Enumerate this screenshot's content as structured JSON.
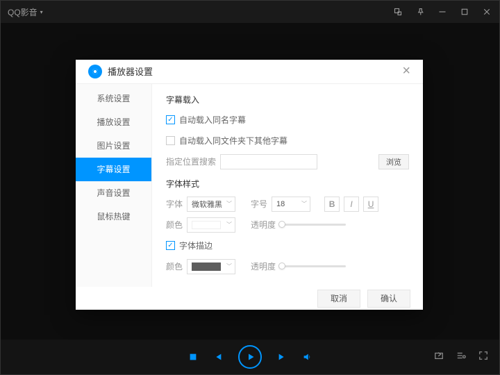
{
  "app": {
    "title": "QQ影音"
  },
  "dialog": {
    "title": "播放器设置",
    "sidebar": {
      "items": [
        {
          "label": "系统设置"
        },
        {
          "label": "播放设置"
        },
        {
          "label": "图片设置"
        },
        {
          "label": "字幕设置"
        },
        {
          "label": "声音设置"
        },
        {
          "label": "鼠标热键"
        }
      ],
      "active_index": 3
    },
    "subtitle_loading": {
      "section_label": "字幕载入",
      "auto_same_name": {
        "label": "自动载入同名字幕",
        "checked": true
      },
      "auto_same_folder": {
        "label": "自动载入同文件夹下其他字幕",
        "checked": false
      },
      "search_path": {
        "label": "指定位置搜索",
        "value": "",
        "browse_label": "浏览"
      }
    },
    "font_style": {
      "section_label": "字体样式",
      "font_label": "字体",
      "font_value": "微软雅黑",
      "size_label": "字号",
      "size_value": "18",
      "bold_label": "B",
      "italic_label": "I",
      "underline_label": "U",
      "color_label": "颜色",
      "opacity_label": "透明度",
      "outline": {
        "label": "字体描边",
        "checked": true
      },
      "outline_color_label": "颜色",
      "outline_opacity_label": "透明度"
    },
    "buttons": {
      "cancel": "取消",
      "ok": "确认"
    }
  }
}
